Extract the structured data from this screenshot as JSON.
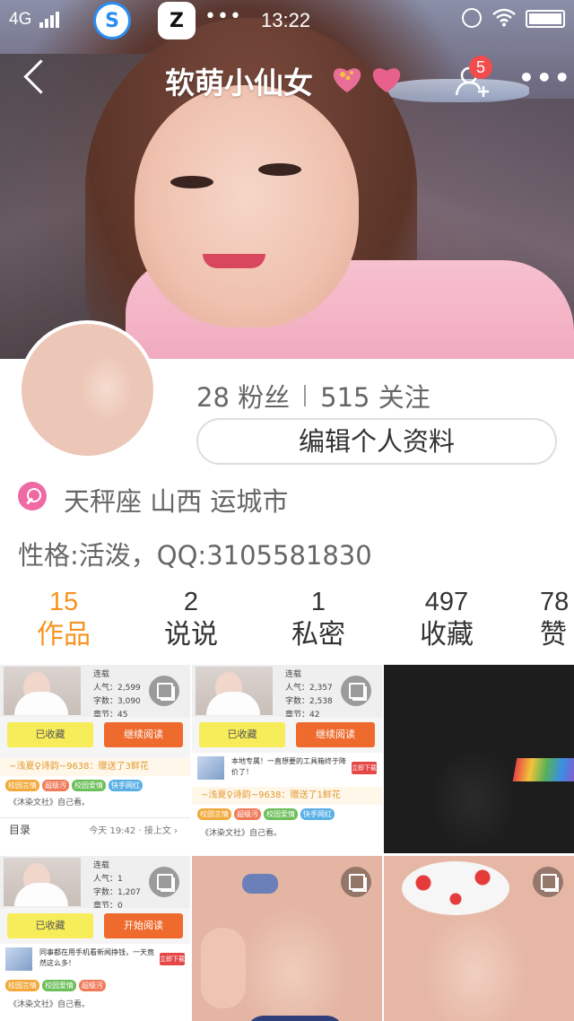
{
  "status_bar": {
    "network": "4G",
    "app_s": "S",
    "app_z": "Z",
    "dots": "•••",
    "time": "13:22"
  },
  "nav": {
    "nickname": "软萌小仙女",
    "friend_badge_count": "5",
    "more": "•••"
  },
  "profile": {
    "fans": "28 粉丝",
    "follows": "515 关注",
    "edit_button": "编辑个人资料",
    "location": "天秤座  山西 运城市",
    "bio": "性格:活泼，QQ:3105581830"
  },
  "tabs": [
    {
      "num": "15",
      "label": "作品",
      "active": true
    },
    {
      "num": "2",
      "label": "说说",
      "active": false
    },
    {
      "num": "1",
      "label": "私密",
      "active": false
    },
    {
      "num": "497",
      "label": "收藏",
      "active": false
    },
    {
      "num": "78",
      "label": "赞",
      "active": false
    }
  ],
  "grid": {
    "cell1": {
      "meta": [
        "连载",
        "人气：2,599",
        "字数：3,090",
        "章节：45"
      ],
      "collected": "已收藏",
      "continue": "继续阅读",
      "gift": "~浅夏♀诗韵~9638：赠送了3鲜花",
      "tags": [
        "校园言情",
        "超级污",
        "校园爱情",
        "快手网红"
      ],
      "author": "《沐染文社》自己看。",
      "toc": "目录",
      "toc_time": "今天 19:42 · 接上文 ›"
    },
    "cell2": {
      "meta": [
        "连载",
        "人气：2,357",
        "字数：2,538",
        "章节：42"
      ],
      "collected": "已收藏",
      "continue": "继续阅读",
      "ad": "本地专属！一直想要的工具箱终于降价了！",
      "ad_go": "立即下载",
      "gift": "~浅夏♀诗韵~9638：赠送了1鲜花",
      "tags": [
        "校园言情",
        "超级污",
        "校园爱情",
        "快手网红"
      ],
      "author": "《沐染文社》自己看。"
    },
    "cell4": {
      "meta": [
        "连载",
        "人气：1",
        "字数：1,207",
        "章节：0"
      ],
      "collected": "已收藏",
      "start": "开始阅读",
      "ad": "同事都在用手机看新闻挣钱，一天竟然这么多！",
      "ad_go": "立即下载",
      "tags": [
        "校园言情",
        "校园爱情",
        "超级污"
      ],
      "author": "《沐染文社》自己看。"
    }
  },
  "colors": {
    "accent": "#f7931e",
    "gender": "#ef6aa4",
    "badge": "#f24c4c"
  }
}
